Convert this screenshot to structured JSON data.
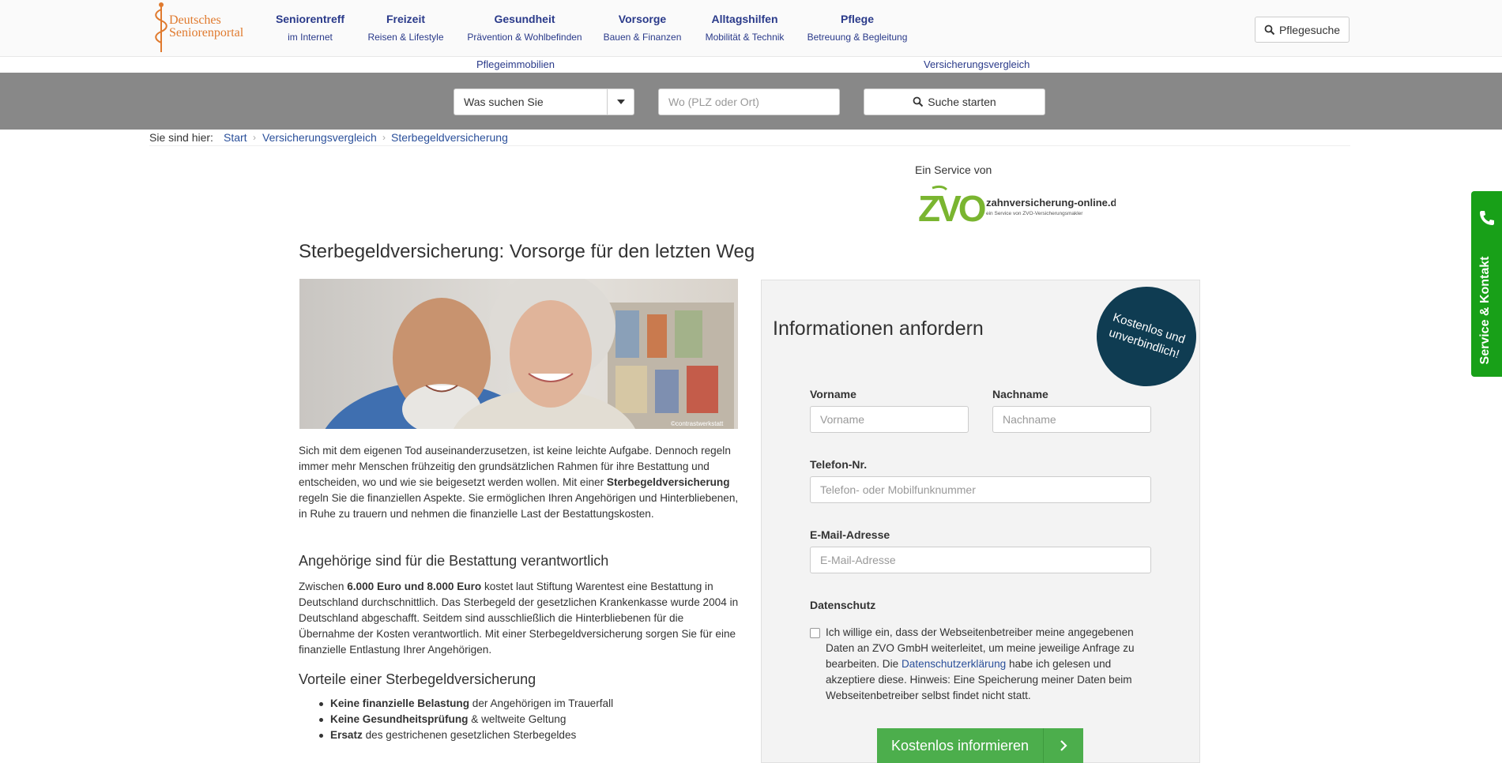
{
  "header": {
    "logo_line1": "Deutsches",
    "logo_line2": "Seniorenportal",
    "nav": [
      {
        "title": "Seniorentreff",
        "sub": "im Internet"
      },
      {
        "title": "Freizeit",
        "sub": "Reisen & Lifestyle"
      },
      {
        "title": "Gesundheit",
        "sub": "Prävention & Wohlbefinden"
      },
      {
        "title": "Vorsorge",
        "sub": "Bauen & Finanzen"
      },
      {
        "title": "Alltagshilfen",
        "sub": "Mobilität & Technik"
      },
      {
        "title": "Pflege",
        "sub": "Betreuung & Begleitung"
      }
    ],
    "pflegesuche": "Pflegesuche",
    "sublinks": [
      "Pflegeimmobilien",
      "Versicherungsvergleich"
    ]
  },
  "search": {
    "select_value": "Was suchen Sie",
    "where_placeholder": "Wo (PLZ oder Ort)",
    "start_label": "Suche starten"
  },
  "breadcrumb": {
    "prefix": "Sie sind hier:",
    "items": [
      "Start",
      "Versicherungsvergleich",
      "Sterbegeldversicherung"
    ]
  },
  "service": {
    "label": "Ein Service von",
    "brand": "ZVO",
    "brand_domain": "zahnversicherung-online.de",
    "brand_tagline": "ein Service von ZVO-Versicherungsmakler"
  },
  "article": {
    "title": "Sterbegeldversicherung: Vorsorge für den letzten Weg",
    "image_credit": "©contrastwerkstatt",
    "intro_a": "Sich mit dem eigenen Tod auseinanderzusetzen, ist keine leichte Aufgabe. Dennoch regeln immer mehr Menschen frühzeitig den grundsätzlichen Rahmen für ihre Bestattung und entscheiden, wo und wie sie beigesetzt werden wollen. Mit einer ",
    "intro_bold": "Sterbegeldversicherung",
    "intro_b": " regeln Sie die finanziellen Aspekte. Sie ermöglichen Ihren Angehörigen und Hinterbliebenen, in Ruhe zu trauern und nehmen die finanzielle Last der Bestattungskosten.",
    "h2_1": "Angehörige sind für die Bestattung verantwortlich",
    "p2_a": "Zwischen ",
    "p2_bold": "6.000 Euro und 8.000 Euro",
    "p2_b": " kostet laut Stiftung Warentest eine Bestattung in Deutschland durchschnittlich. Das Sterbegeld der gesetzlichen Krankenkasse wurde 2004 in Deutschland abgeschafft. Seitdem sind ausschließlich die Hinterbliebenen für die Übernahme der Kosten verantwortlich. Mit einer Sterbegeldversicherung sorgen Sie für eine finanzielle Entlastung Ihrer Angehörigen.",
    "h2_2": "Vorteile einer Sterbegeldversicherung",
    "bullets": [
      {
        "bold": "Keine finanzielle Belastung",
        "rest": " der Angehörigen im Trauerfall"
      },
      {
        "bold": "Keine Gesundheitsprüfung",
        "rest": " & weltweite Geltung"
      },
      {
        "bold": "Ersatz",
        "rest": " des gestrichenen gesetzlichen Sterbegeldes"
      }
    ]
  },
  "form": {
    "title": "Informationen anfordern",
    "badge": "Kostenlos und unverbindlich!",
    "vorname_label": "Vorname",
    "vorname_placeholder": "Vorname",
    "nachname_label": "Nachname",
    "nachname_placeholder": "Nachname",
    "telefon_label": "Telefon-Nr.",
    "telefon_placeholder": "Telefon- oder Mobilfunknummer",
    "email_label": "E-Mail-Adresse",
    "email_placeholder": "E-Mail-Adresse",
    "datenschutz_label": "Datenschutz",
    "consent_a": "Ich willige ein, dass der Webseitenbetreiber meine angegebenen Daten an ZVO GmbH weiterleitet, um meine jeweilige Anfrage zu bearbeiten. Die ",
    "consent_link": "Datenschutzerklärung",
    "consent_b": " habe ich gelesen und akzeptiere diese. Hinweis: Eine Speicherung meiner Daten beim Webseitenbetreiber selbst findet nicht statt.",
    "submit_label": "Kostenlos informieren"
  },
  "sidetab": {
    "label": "Service & Kontakt"
  },
  "colors": {
    "nav": "#2a3a8a",
    "link": "#2a4f9a",
    "green": "#4cae4c",
    "badge": "#0f3c52",
    "sidetab": "#18a018",
    "band": "#888888"
  }
}
